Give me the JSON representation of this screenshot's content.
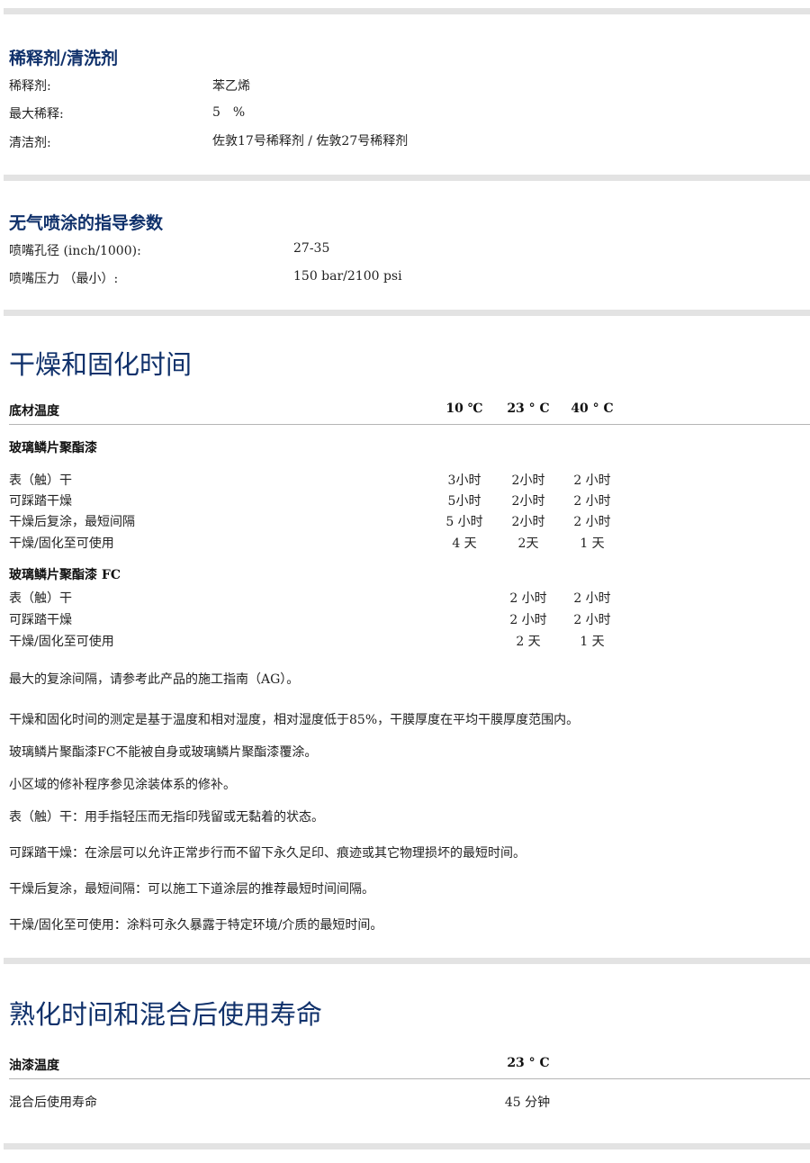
{
  "thinner": {
    "title": "稀释剂/清洗剂",
    "rows": [
      {
        "label": "稀释剂:",
        "value": "苯乙烯"
      },
      {
        "label": "最大稀释:",
        "value": "5　%"
      },
      {
        "label": "清洁剂:",
        "value": "佐敦17号稀释剂 / 佐敦27号稀释剂"
      }
    ]
  },
  "airless": {
    "title": "无气喷涂的指导参数",
    "rows": [
      {
        "label": "喷嘴孔径 (inch/1000):",
        "value": "27-35"
      },
      {
        "label": "喷嘴压力 （最小）:",
        "value": "150 bar/2100 psi"
      }
    ]
  },
  "drying": {
    "title": "干燥和固化时间",
    "header": {
      "label": "底材温度",
      "t10": "10 ℃",
      "t23": "23 ° C",
      "t40": "40 ° C"
    },
    "group1": {
      "title": "玻璃鳞片聚酯漆",
      "rows": [
        {
          "label": "表（触）干",
          "t10": "3小时",
          "t23": "2小时",
          "t40": "2 小时"
        },
        {
          "label": "可踩踏干燥",
          "t10": "5小时",
          "t23": "2小时",
          "t40": "2 小时"
        },
        {
          "label": "干燥后复涂，最短间隔",
          "t10": "5 小时",
          "t23": "2小时",
          "t40": "2 小时"
        },
        {
          "label": "干燥/固化至可使用",
          "t10": "4 天",
          "t23": "2天",
          "t40": "1 天"
        }
      ]
    },
    "group2": {
      "title": "玻璃鳞片聚酯漆 FC",
      "rows": [
        {
          "label": "表（触）干",
          "t23": "2 小时",
          "t40": "2 小时"
        },
        {
          "label": "可踩踏干燥",
          "t23": "2 小时",
          "t40": "2 小时"
        },
        {
          "label": "干燥/固化至可使用",
          "t23": "2 天",
          "t40": "1 天"
        }
      ]
    },
    "notes": [
      "最大的复涂间隔，请参考此产品的施工指南（AG）。",
      "干燥和固化时间的测定是基于温度和相对湿度，相对湿度低于85%，干膜厚度在平均干膜厚度范围内。",
      "玻璃鳞片聚酯漆FC不能被自身或玻璃鳞片聚酯漆覆涂。",
      "小区域的修补程序参见涂装体系的修补。",
      "表（触）干：用手指轻压而无指印残留或无黏着的状态。",
      "可踩踏干燥：在涂层可以允许正常步行而不留下永久足印、痕迹或其它物理损坏的最短时间。",
      "干燥后复涂，最短间隔：可以施工下道涂层的推荐最短时间间隔。",
      "干燥/固化至可使用：涂料可永久暴露于特定环境/介质的最短时间。"
    ]
  },
  "potlife": {
    "title": "熟化时间和混合后使用寿命",
    "header": {
      "label": "油漆温度",
      "t23": "23 ° C"
    },
    "rows": [
      {
        "label": "混合后使用寿命",
        "t23": "45 分钟"
      }
    ]
  }
}
